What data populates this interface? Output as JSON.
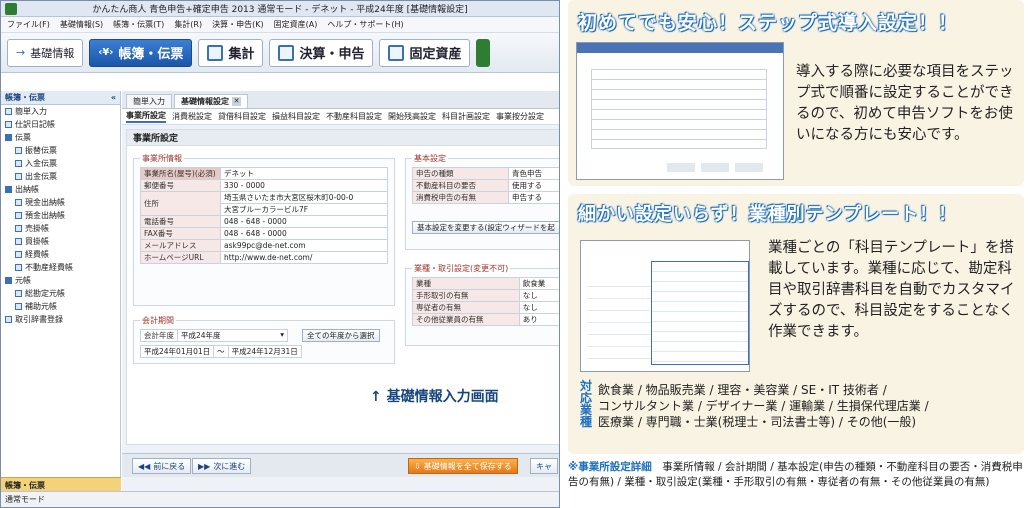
{
  "window": {
    "title": "かんたん商人 青色申告+確定申告 2013 通常モード - デネット - 平成24年度 [基礎情報設定]"
  },
  "menu": [
    "ファイル(F)",
    "基礎情報(S)",
    "帳簿・伝票(T)",
    "集計(R)",
    "決算・申告(K)",
    "固定資産(A)",
    "ヘルプ・サポート(H)"
  ],
  "nav": {
    "basic": "基礎情報",
    "books": "帳簿・伝票",
    "summary": "集計",
    "settle": "決算・申告",
    "assets": "固定資産"
  },
  "sidebar": {
    "title": "帳簿・伝票",
    "collapse": "«",
    "items": [
      "簡単入力",
      "仕訳日記帳",
      "伝票",
      "振替伝票",
      "入金伝票",
      "出金伝票",
      "出納帳",
      "現金出納帳",
      "預金出納帳",
      "売掛帳",
      "買掛帳",
      "経費帳",
      "不動産経費帳",
      "元帳",
      "総勘定元帳",
      "補助元帳",
      "取引辞書登録"
    ],
    "footer": "帳簿・伝票"
  },
  "tabs": {
    "t1": "簡単入力",
    "t2": "基礎情報設定",
    "close": "✕"
  },
  "subtabs": [
    "事業所設定",
    "消費税設定",
    "貸借科目設定",
    "損益科目設定",
    "不動産科目設定",
    "開始残高設定",
    "科目計画設定",
    "事業按分設定"
  ],
  "content": {
    "title": "事業所設定",
    "office": {
      "title": "事業所情報",
      "name_l": "事業所名(屋号)(必須)",
      "name_v": "デネット",
      "zip_l": "郵便番号",
      "zip1": "330",
      "zip2": "0000",
      "addr_l": "住所",
      "addr1": "埼玉県さいたま市大宮区桜木町0-00-0",
      "addr2": "大宮ブルーカラービル7F",
      "tel_l": "電話番号",
      "tel1": "048",
      "tel2": "648",
      "tel3": "0000",
      "fax_l": "FAX番号",
      "fax1": "048",
      "fax2": "648",
      "fax3": "0000",
      "mail_l": "メールアドレス",
      "mail_v": "ask99pc@de-net.com",
      "url_l": "ホームページURL",
      "url_v": "http://www.de-net.com/"
    },
    "period": {
      "title": "会計期間",
      "year_l": "会計年度",
      "year_v": "平成24年度",
      "all_btn": "全ての年度から選択",
      "start": "平成24年01月01日",
      "tilde": "〜",
      "end": "平成24年12月31日"
    },
    "basic": {
      "title": "基本設定",
      "r1l": "申告の種類",
      "r1v": "青色申告",
      "r2l": "不動産科目の要否",
      "r2v": "使用する",
      "r3l": "消費税申告の有無",
      "r3v": "申告する",
      "btn": "基本設定を変更する(設定ウィザードを起"
    },
    "industry": {
      "title": "業種・取引設定(変更不可)",
      "r1l": "業種",
      "r1v": "飲食業",
      "r2l": "手形取引の有無",
      "r2v": "なし",
      "r3l": "専従者の有無",
      "r3v": "なし",
      "r4l": "その他従業員の有無",
      "r4v": "あり"
    },
    "caption": "↑ 基礎情報入力画面"
  },
  "bottom": {
    "prev": "前に戻る",
    "next": "次に進む",
    "save": "基礎情報を全て保存する",
    "cancel": "キャ"
  },
  "status": "通常モード",
  "panel1": {
    "title": "初めてでも安心！ステップ式導入設定！！",
    "text": "導入する際に必要な項目をステップ式で順番に設定することができるので、初めて申告ソフトをお使いになる方にも安心です。"
  },
  "panel2": {
    "title": "細かい設定いらず！業種別テンプレート！！",
    "text": "業種ごとの「科目テンプレート」を搭載しています。業種に応じて、勘定科目や取引辞書科目を自動でカスタマイズするので、科目設定をすることなく作業できます。",
    "tag": "対応業種",
    "l1": "飲食業 / 物品販売業 / 理容・美容業 / SE・IT 技術者 /",
    "l2": "コンサルタント業 / デザイナー業 / 運輸業 / 生損保代理店業 /",
    "l3": "医療業 / 専門職・士業(税理士・司法書士等) / その他(一般)"
  },
  "note": {
    "head": "※事業所設定詳細",
    "body": "事業所情報 / 会計期間 / 基本設定(申告の種類・不動産科目の要否・消費税申告の有無) / 業種・取引設定(業種・手形取引の有無・専従者の有無・その他従業員の有無)"
  }
}
